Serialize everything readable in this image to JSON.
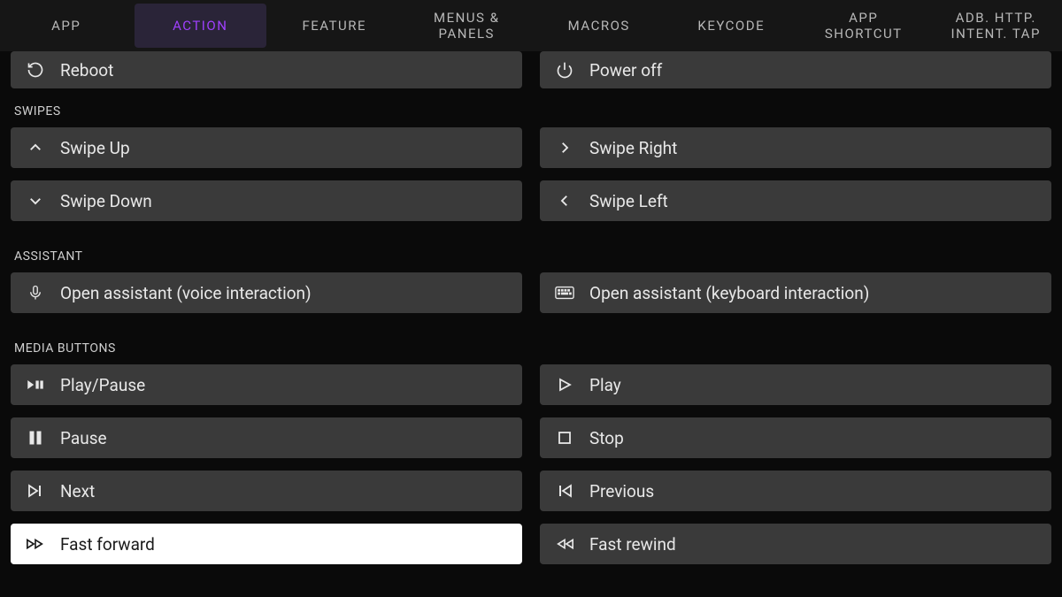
{
  "tabs": [
    {
      "label": "APP"
    },
    {
      "label": "ACTION"
    },
    {
      "label": "FEATURE"
    },
    {
      "label": "MENUS &\nPANELS"
    },
    {
      "label": "MACROS"
    },
    {
      "label": "KEYCODE"
    },
    {
      "label": "APP\nSHORTCUT"
    },
    {
      "label": "ADB. HTTP.\nINTENT. TAP"
    }
  ],
  "activeTab": 1,
  "power": {
    "reboot": "Reboot",
    "poweroff": "Power off"
  },
  "sections": {
    "swipes": {
      "title": "SWIPES",
      "up": "Swipe Up",
      "down": "Swipe Down",
      "right": "Swipe Right",
      "left": "Swipe Left"
    },
    "assistant": {
      "title": "ASSISTANT",
      "voice": "Open assistant (voice interaction)",
      "keyboard": "Open assistant (keyboard interaction)"
    },
    "media": {
      "title": "MEDIA BUTTONS",
      "playpause": "Play/Pause",
      "pause": "Pause",
      "next": "Next",
      "fastforward": "Fast forward",
      "play": "Play",
      "stop": "Stop",
      "previous": "Previous",
      "fastrewind": "Fast rewind"
    }
  }
}
